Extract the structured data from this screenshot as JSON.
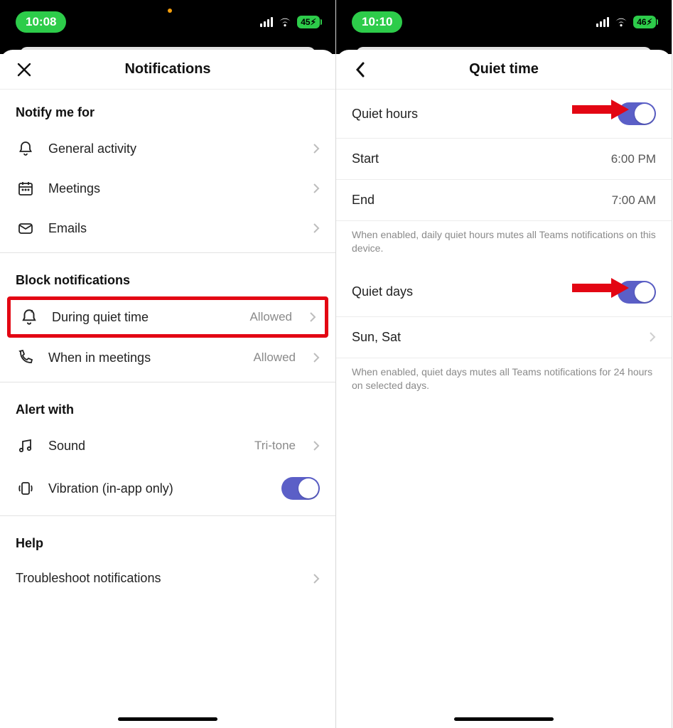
{
  "left": {
    "status": {
      "time": "10:08",
      "battery": "45"
    },
    "header": {
      "title": "Notifications"
    },
    "sections": {
      "notify_title": "Notify me for",
      "notify_items": [
        {
          "label": "General activity"
        },
        {
          "label": "Meetings"
        },
        {
          "label": "Emails"
        }
      ],
      "block_title": "Block notifications",
      "block_items": [
        {
          "label": "During quiet time",
          "value": "Allowed"
        },
        {
          "label": "When in meetings",
          "value": "Allowed"
        }
      ],
      "alert_title": "Alert with",
      "alert_items": {
        "sound_label": "Sound",
        "sound_value": "Tri-tone",
        "vibration_label": "Vibration (in-app only)"
      },
      "help_title": "Help",
      "help_item": "Troubleshoot notifications"
    }
  },
  "right": {
    "status": {
      "time": "10:10",
      "battery": "46"
    },
    "header": {
      "title": "Quiet time"
    },
    "quiet_hours": {
      "label": "Quiet hours",
      "start_label": "Start",
      "start_value": "6:00 PM",
      "end_label": "End",
      "end_value": "7:00 AM",
      "footnote": "When enabled, daily quiet hours mutes all Teams notifications on this device."
    },
    "quiet_days": {
      "label": "Quiet days",
      "days_value": "Sun, Sat",
      "footnote": "When enabled, quiet days mutes all Teams notifications for 24 hours on selected days."
    }
  }
}
